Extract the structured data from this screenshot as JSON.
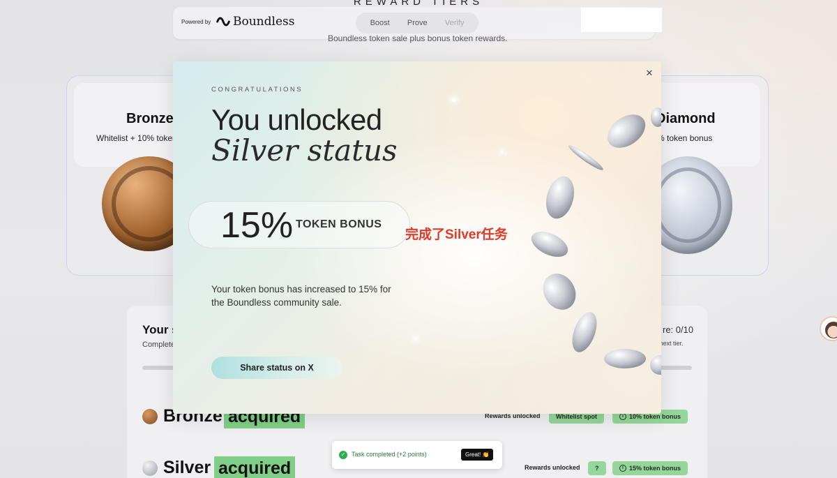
{
  "background": {
    "section_title": "REWARD TIERS",
    "subtitle": "Boundless token sale plus bonus token rewards.",
    "topbar": {
      "powered_by": "Powered by",
      "brand": "Boundless",
      "nav": [
        "Boost",
        "Prove",
        "Verify"
      ]
    },
    "tiers": {
      "left": {
        "name": "Bronze",
        "desc": "Whitelist + 10% token"
      },
      "right": {
        "name": "Diamond",
        "desc": "% token bonus"
      }
    },
    "status": {
      "title": "Your s",
      "subtitle": "Complete",
      "score": "re: 0/10",
      "next_tier": "e next tier."
    },
    "rows": [
      {
        "name": "Bronze",
        "badge": "acquired",
        "rewards_label": "Rewards unlocked",
        "chips": [
          "Whitelist spot",
          "10% token bonus"
        ]
      },
      {
        "name": "Silver",
        "badge": "acquired",
        "rewards_label": "Rewards unlocked",
        "chips": [
          "?",
          "15% token bonus"
        ]
      }
    ],
    "toast": {
      "text": "Task completed (+2 points)",
      "button": "Great! 👏"
    }
  },
  "modal": {
    "eyebrow": "CONGRATULATIONS",
    "headline": "You unlocked",
    "headline_italic": "Silver status",
    "bonus_value": "15%",
    "bonus_label": "TOKEN BONUS",
    "annotation": "完成了Silver任务",
    "body": "Your token bonus has increased to 15% for the Boundless community sale.",
    "share_button": "Share status on X",
    "close_icon": "close-icon"
  },
  "colors": {
    "accent_green": "#7fcf86",
    "annotation_red": "#e23a2a",
    "share_button_teal": "#aee0df"
  }
}
